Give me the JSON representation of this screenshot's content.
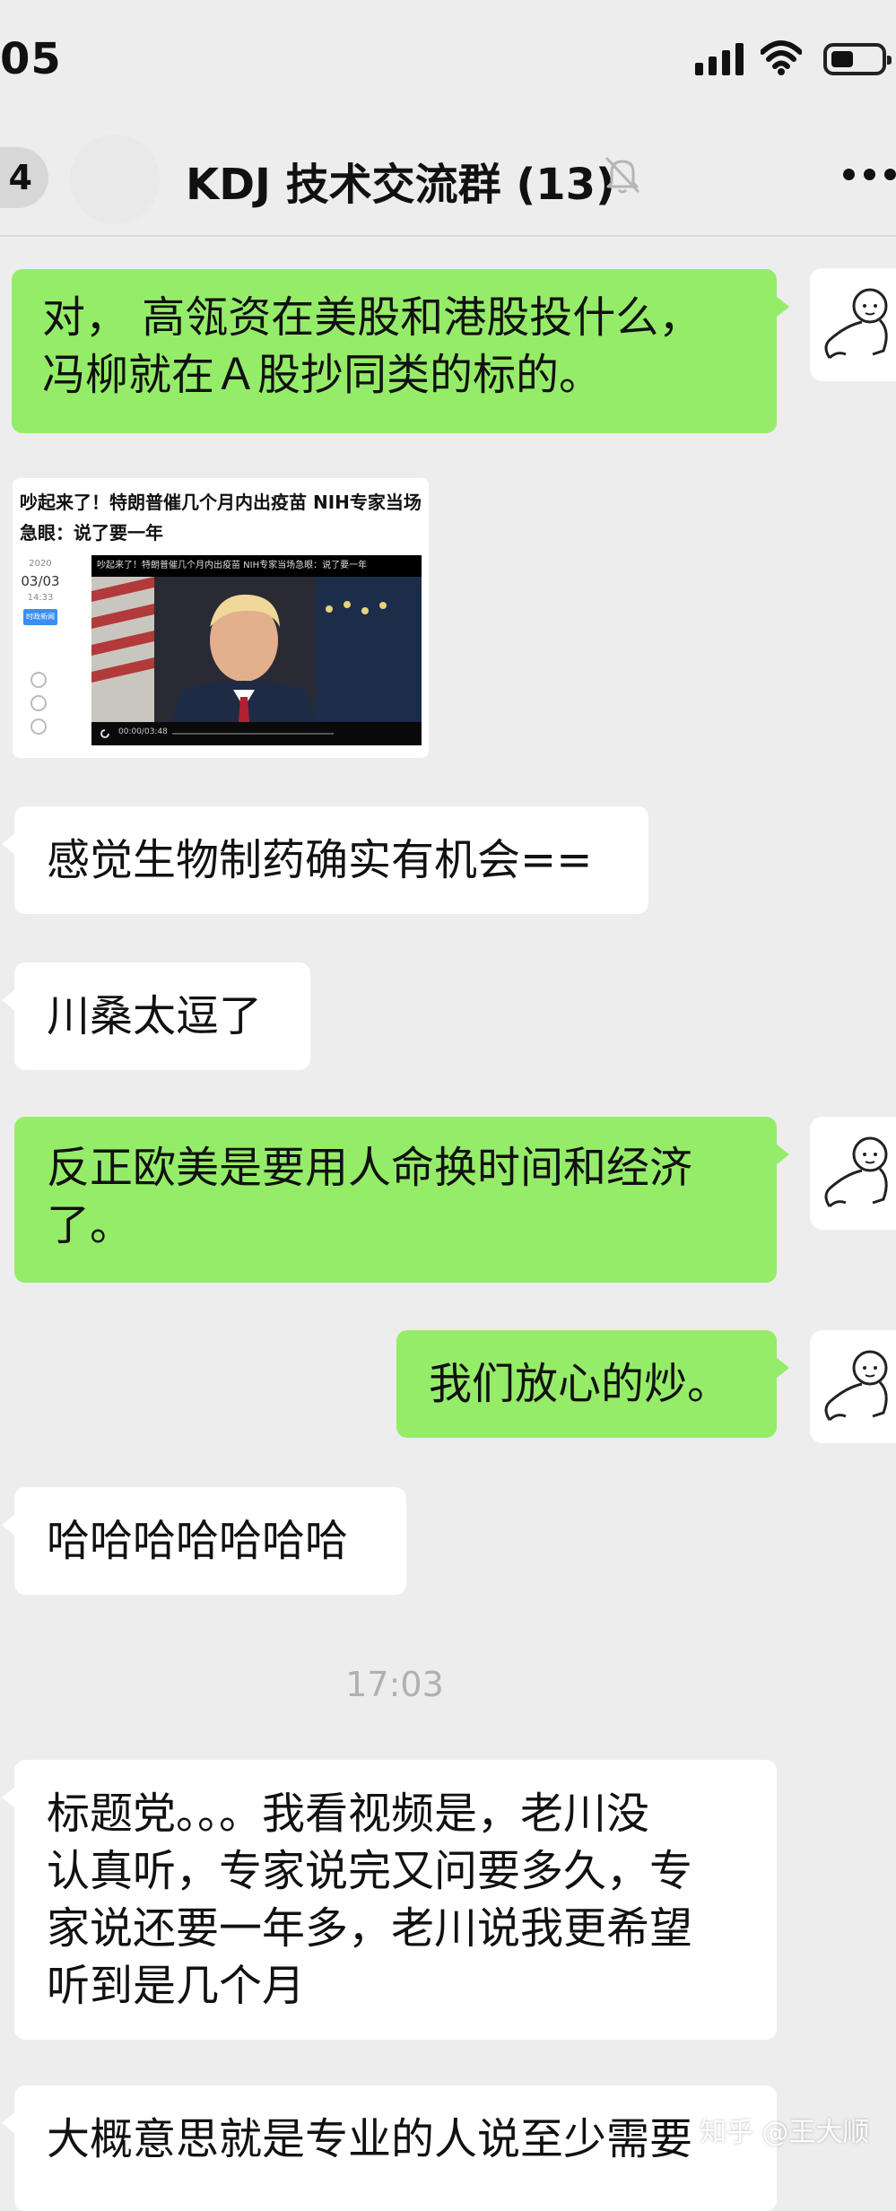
{
  "status_bar": {
    "time": "05"
  },
  "header": {
    "back_count": "4",
    "title": "KDJ 技术交流群 (13)"
  },
  "messages": [
    {
      "side": "right",
      "lines": [
        "对，  高瓴资在美股和港股投什么，",
        "  冯柳就在Ａ股抄同类的标的。"
      ]
    },
    {
      "side": "left",
      "type": "link-card",
      "title": "吵起来了！特朗普催几个月内出疫苗 NIH专家当场急眼：说了要一年",
      "date_year": "2020",
      "date_md": "03/03",
      "date_time": "14:33",
      "tag": "时政新闻",
      "video_title": "吵起来了！特朗普催几个月内出疫苗 NIH专家当场急眼：说了要一年",
      "video_time": "00:00/03:48"
    },
    {
      "side": "left",
      "lines": [
        "感觉生物制药确实有机会=="
      ]
    },
    {
      "side": "left",
      "lines": [
        "川桑太逗了"
      ]
    },
    {
      "side": "right",
      "lines": [
        "反正欧美是要用人命换时间和经济",
        "了。"
      ]
    },
    {
      "side": "right",
      "lines": [
        "我们放心的炒。"
      ]
    },
    {
      "side": "left",
      "lines": [
        "哈哈哈哈哈哈哈"
      ]
    },
    {
      "side": "left",
      "lines": [
        "标题党。。。我看视频是，老川没",
        "认真听，专家说完又问要多久，专",
        "家说还要一年多，老川说我更希望",
        "听到是几个月"
      ]
    },
    {
      "side": "left",
      "lines": [
        "大概意思就是专业的人说至少需要"
      ]
    }
  ],
  "time_separator": "17:03",
  "watermark": "知乎 @王大顺",
  "colors": {
    "background": "#ededed",
    "bubble_self": "#95ec69",
    "bubble_other": "#ffffff"
  },
  "icons": [
    "signal-icon",
    "wifi-icon",
    "battery-icon",
    "mute-bell-icon",
    "more-icon",
    "sticker-avatar-icon"
  ]
}
